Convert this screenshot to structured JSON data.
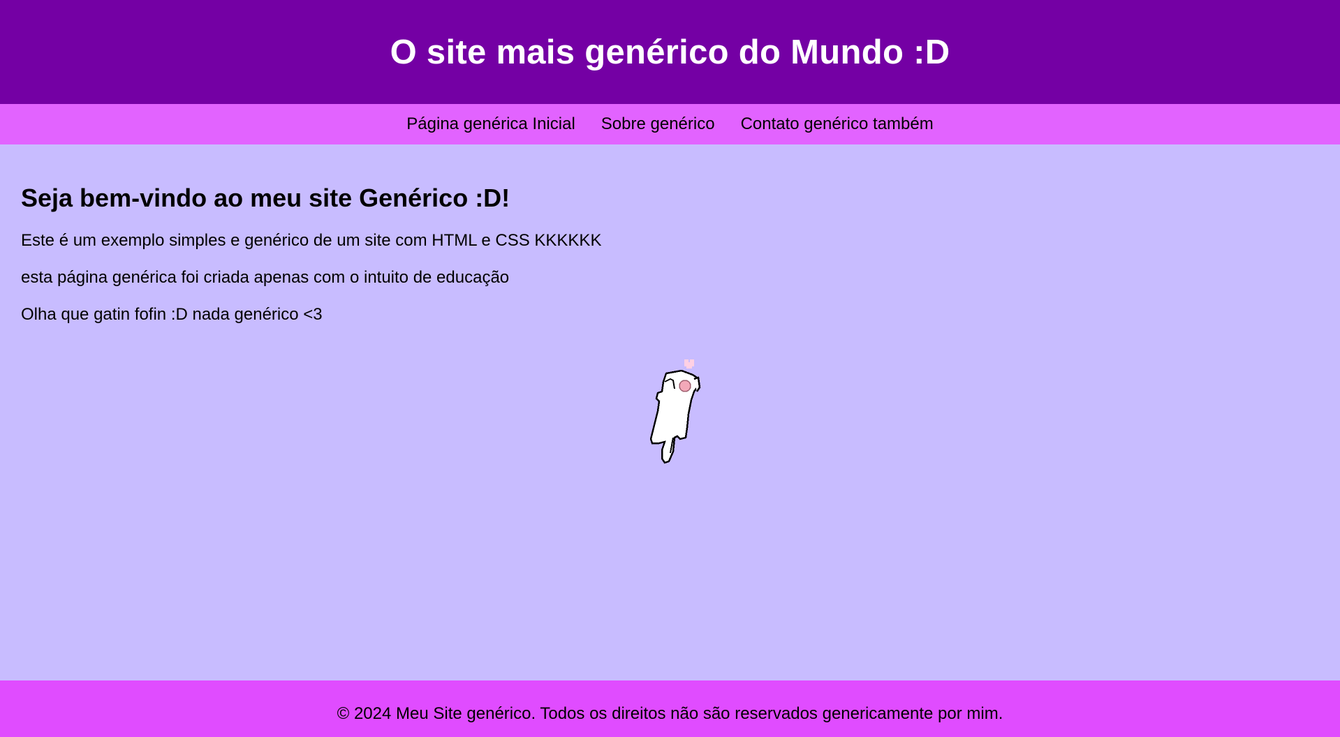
{
  "header": {
    "title": "O site mais genérico do Mundo :D"
  },
  "nav": {
    "items": [
      {
        "label": "Página genérica Inicial"
      },
      {
        "label": "Sobre genérico"
      },
      {
        "label": "Contato genérico também"
      }
    ]
  },
  "main": {
    "heading": "Seja bem-vindo ao meu site Genérico :D!",
    "paragraphs": [
      "Este é um exemplo simples e genérico de um site com HTML e CSS KKKKKK",
      "esta página genérica foi criada apenas com o intuito de educação",
      "Olha que gatin fofin :D nada genérico <3"
    ],
    "image": {
      "icon": "cat-illustration"
    }
  },
  "footer": {
    "text": "© 2024 Meu Site genérico. Todos os direitos não são reservados genericamente por mim."
  },
  "colors": {
    "header_bg": "#7400a4",
    "nav_bg": "#e263ff",
    "main_bg": "#c8bcff",
    "footer_bg": "#e04cff"
  }
}
